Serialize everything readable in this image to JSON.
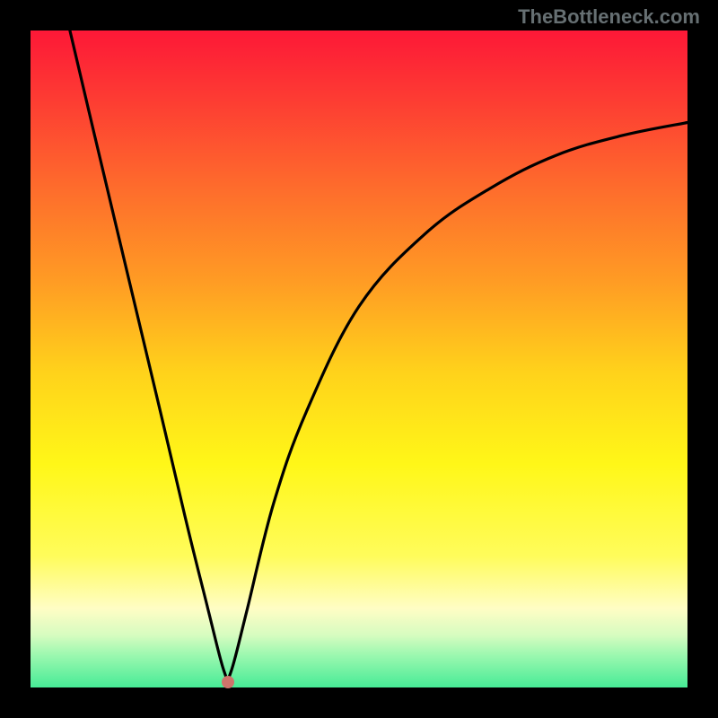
{
  "attribution": "TheBottleneck.com",
  "marker": {
    "x_frac": 0.3,
    "y_frac": 0.992
  },
  "colors": {
    "curve_stroke": "#000000",
    "marker_fill": "#cf746b",
    "gradient_top": "#fd1837",
    "gradient_bottom": "#47eb96",
    "border": "#000000"
  },
  "chart_data": {
    "type": "line",
    "title": "",
    "xlabel": "",
    "ylabel": "",
    "xlim": [
      0,
      1
    ],
    "ylim": [
      0,
      1
    ],
    "grid": false,
    "series": [
      {
        "name": "curve",
        "x": [
          0.06,
          0.1,
          0.15,
          0.2,
          0.24,
          0.27,
          0.29,
          0.3,
          0.31,
          0.33,
          0.37,
          0.42,
          0.5,
          0.6,
          0.7,
          0.8,
          0.9,
          1.0
        ],
        "y": [
          1.0,
          0.83,
          0.62,
          0.41,
          0.24,
          0.12,
          0.04,
          0.01,
          0.04,
          0.12,
          0.28,
          0.42,
          0.58,
          0.69,
          0.76,
          0.81,
          0.84,
          0.86
        ]
      }
    ],
    "annotations": [
      {
        "type": "point",
        "x": 0.3,
        "y": 0.008,
        "label": "minimum-marker"
      }
    ]
  }
}
